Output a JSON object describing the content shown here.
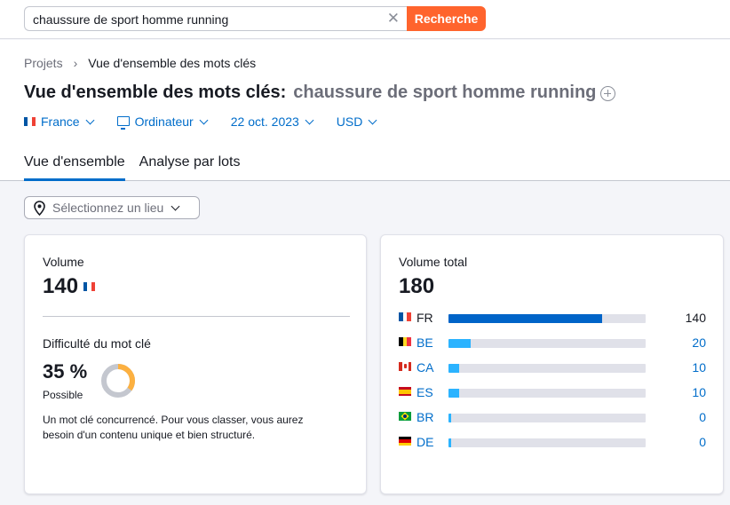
{
  "search": {
    "value": "chaussure de sport homme running",
    "button_label": "Recherche"
  },
  "breadcrumb": {
    "root": "Projets",
    "current": "Vue d'ensemble des mots clés"
  },
  "title": {
    "prefix": "Vue d'ensemble des mots clés:",
    "keyword": "chaussure de sport homme running"
  },
  "filters": {
    "country": "France",
    "device": "Ordinateur",
    "date": "22 oct. 2023",
    "currency": "USD"
  },
  "tabs": [
    {
      "label": "Vue d'ensemble"
    },
    {
      "label": "Analyse par lots"
    }
  ],
  "location": {
    "placeholder": "Sélectionnez un lieu"
  },
  "volume_card": {
    "volume_label": "Volume",
    "volume_value": "140",
    "kd_label": "Difficulté du mot clé",
    "kd_value": "35 %",
    "kd_percent": 35,
    "kd_level": "Possible",
    "kd_description": "Un mot clé concurrencé. Pour vous classer, vous aurez besoin d'un contenu unique et bien structuré."
  },
  "total_card": {
    "label": "Volume total",
    "value": "180",
    "countries": [
      {
        "code": "FR",
        "value": 140,
        "display": "140"
      },
      {
        "code": "BE",
        "value": 20,
        "display": "20"
      },
      {
        "code": "CA",
        "value": 10,
        "display": "10"
      },
      {
        "code": "ES",
        "value": 10,
        "display": "10"
      },
      {
        "code": "BR",
        "value": 0,
        "display": "0"
      },
      {
        "code": "DE",
        "value": 0,
        "display": "0"
      }
    ]
  },
  "colors": {
    "accent_orange": "#ff642d",
    "link_blue": "#006dca",
    "bar_primary": "#0064c8",
    "bar_secondary": "#2bb3ff",
    "bar_track": "#e0e1e9",
    "kd_arc": "#fcb040",
    "kd_track": "#c4c7cf"
  }
}
